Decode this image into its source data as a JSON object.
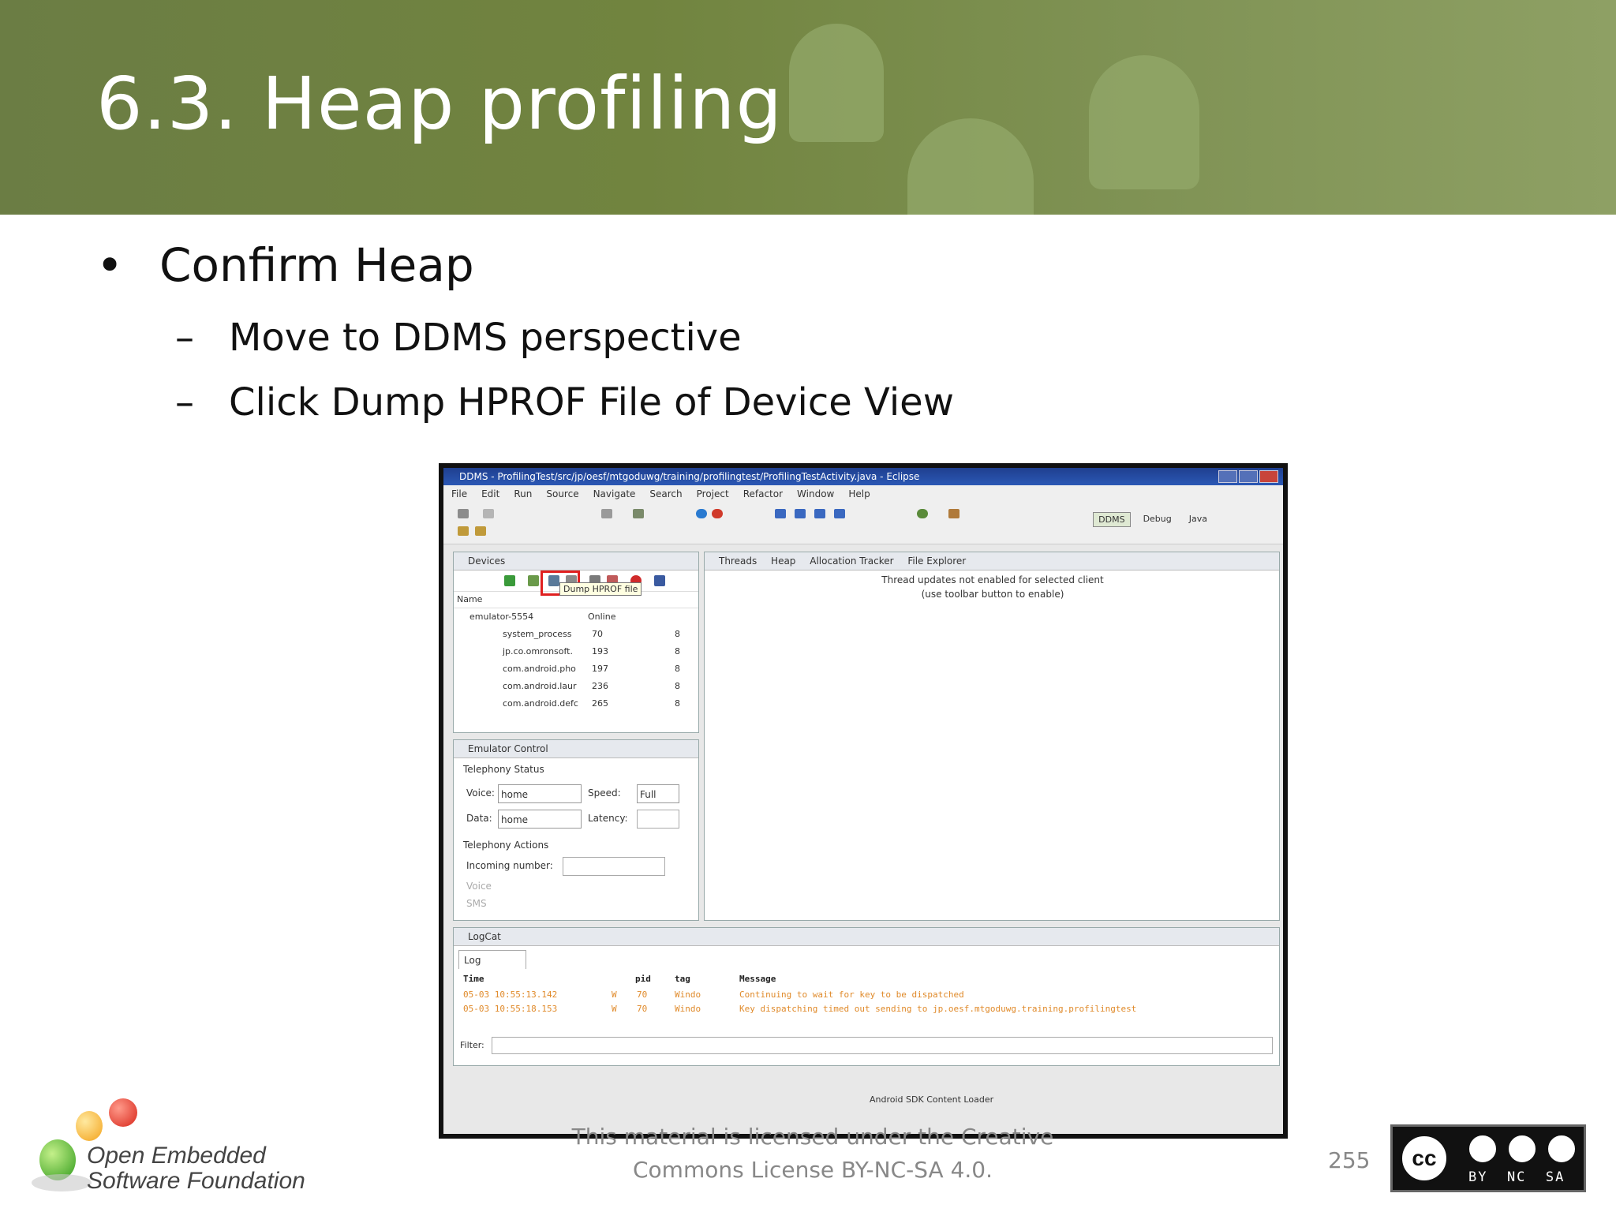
{
  "slide": {
    "title": "6.3. Heap profiling",
    "bullet": "Confirm Heap",
    "bullet_marker": "•",
    "sub_marker": "–",
    "sub_bullets": [
      "Move to  DDMS perspective",
      "Click Dump HPROF File of Device View"
    ],
    "footer": "This material is licensed under the Creative Commons License BY-NC-SA 4.0.",
    "page_number": "255",
    "logo_line1": "Open Embedded",
    "logo_line2": "Software Foundation",
    "cc_label": "BY  NC  SA"
  },
  "eclipse": {
    "window_title": "DDMS - ProfilingTest/src/jp/oesf/mtgoduwg/training/profilingtest/ProfilingTestActivity.java - Eclipse",
    "menu": [
      "File",
      "Edit",
      "Run",
      "Source",
      "Navigate",
      "Search",
      "Project",
      "Refactor",
      "Window",
      "Help"
    ],
    "perspectives": [
      "DDMS",
      "Debug",
      "Java"
    ],
    "devices_tab": "Devices",
    "tooltip": "Dump HPROF file",
    "device_columns": [
      "Name"
    ],
    "device_rows": [
      {
        "name": "emulator-5554",
        "pid": "",
        "status": "Online"
      },
      {
        "name": "system_process",
        "pid": "70",
        "status": "8"
      },
      {
        "name": "jp.co.omronsoft.",
        "pid": "193",
        "status": "8"
      },
      {
        "name": "com.android.pho",
        "pid": "197",
        "status": "8"
      },
      {
        "name": "com.android.laur",
        "pid": "236",
        "status": "8"
      },
      {
        "name": "com.android.defc",
        "pid": "265",
        "status": "8"
      }
    ],
    "right_tabs": [
      "Threads",
      "Heap",
      "Allocation Tracker",
      "File Explorer"
    ],
    "thread_msg_line1": "Thread updates not enabled for selected client",
    "thread_msg_line2": "(use toolbar button to enable)",
    "emulator_tab": "Emulator Control",
    "telephony_status": "Telephony Status",
    "voice_label": "Voice:",
    "voice_value": "home",
    "speed_label": "Speed:",
    "speed_value": "Full",
    "data_label": "Data:",
    "data_value": "home",
    "latency_label": "Latency:",
    "telephony_actions": "Telephony Actions",
    "incoming_label": "Incoming number:",
    "radio_voice": "Voice",
    "radio_sms": "SMS",
    "logcat_tab": "LogCat",
    "log_subtab": "Log",
    "log_columns": [
      "Time",
      "pid",
      "tag",
      "Message"
    ],
    "log_rows": [
      {
        "time": "05-03 10:55:13.142",
        "level": "W",
        "pid": "70",
        "tag": "Windo",
        "msg": "Continuing to wait for key to be dispatched"
      },
      {
        "time": "05-03 10:55:18.153",
        "level": "W",
        "pid": "70",
        "tag": "Windo",
        "msg": "Key dispatching timed out sending to jp.oesf.mtgoduwg.training.profilingtest"
      }
    ],
    "filter_label": "Filter:",
    "status_text": "Android SDK Content Loader"
  }
}
